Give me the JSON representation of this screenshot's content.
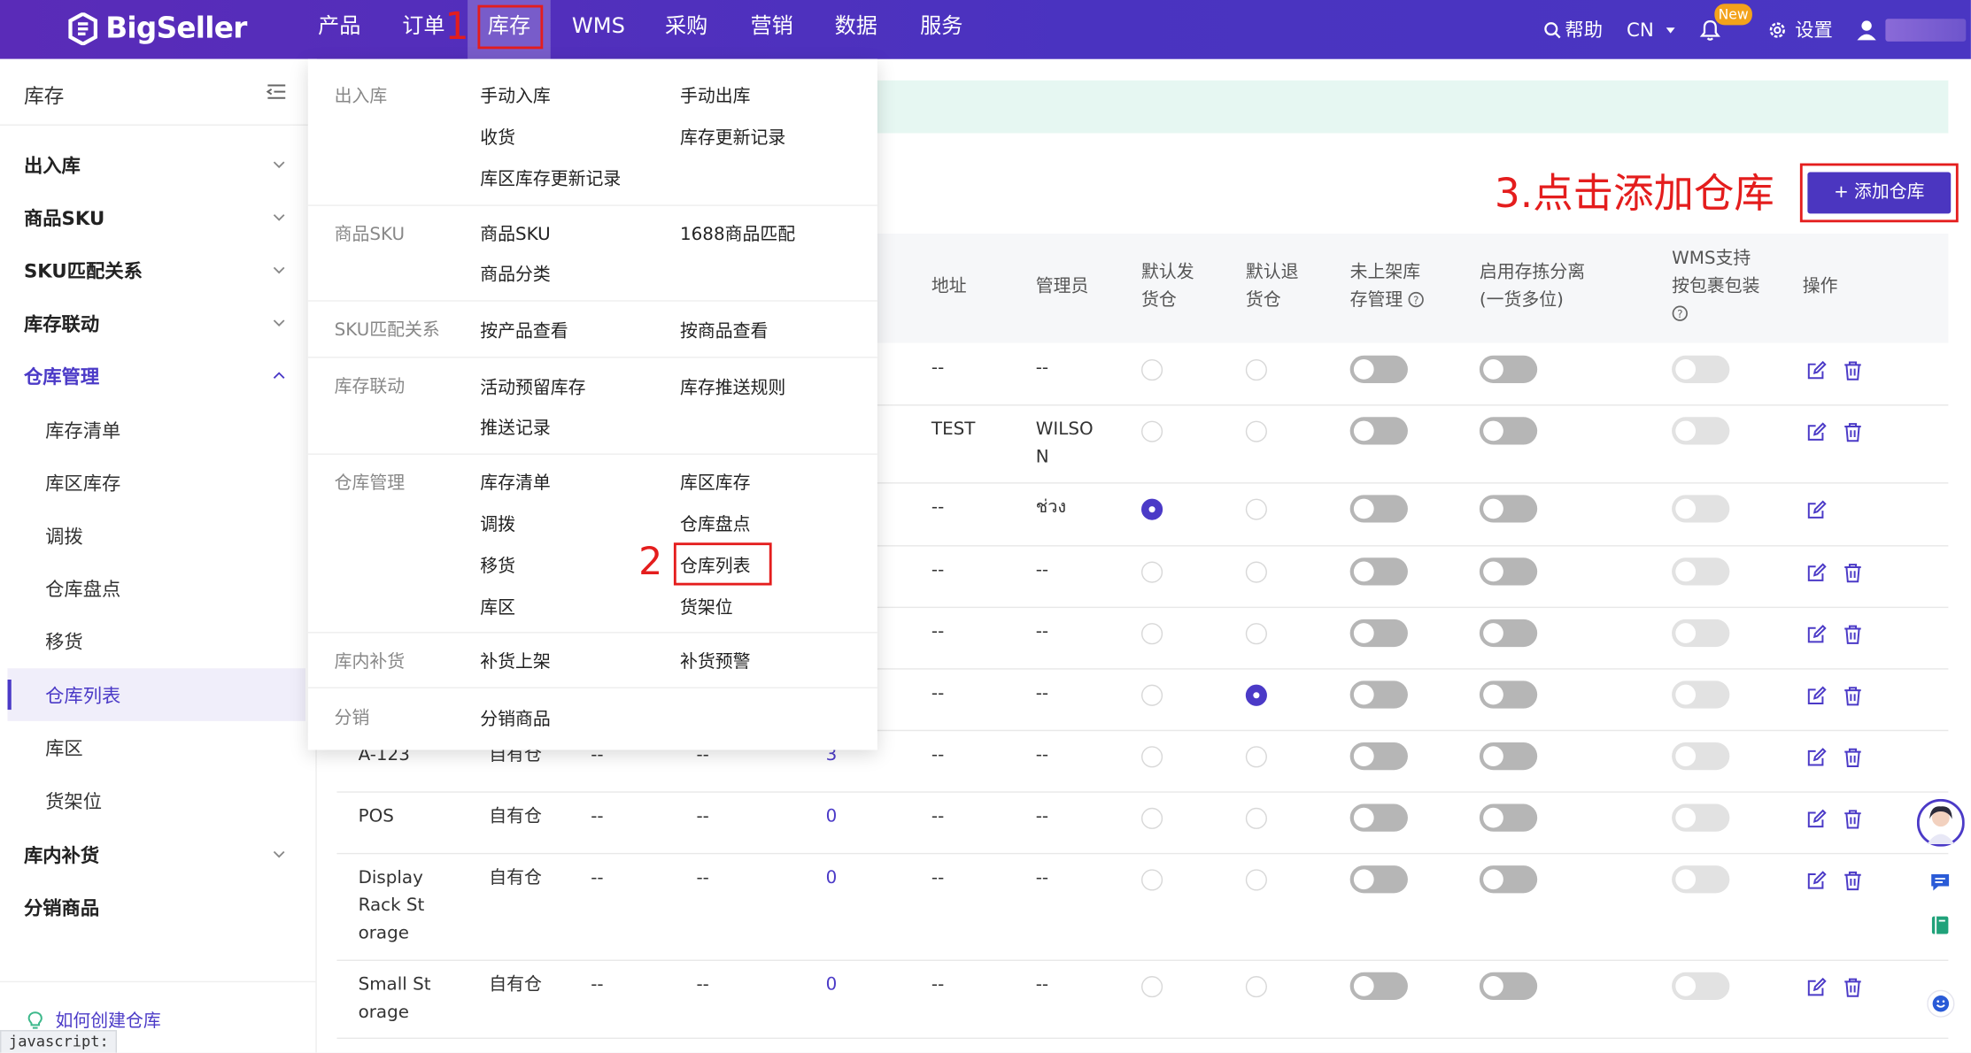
{
  "app": {
    "logo_text": "BigSeller"
  },
  "topnav": {
    "items": [
      "产品",
      "订单",
      "库存",
      "WMS",
      "采购",
      "营销",
      "数据",
      "服务"
    ],
    "help": "帮助",
    "lang": "CN",
    "new_badge": "New",
    "settings": "设置"
  },
  "annotations": {
    "step1": "1",
    "step2": "2",
    "step3": "3.点击添加仓库"
  },
  "sidebar": {
    "title": "库存",
    "groups": [
      "出入库",
      "商品SKU",
      "SKU匹配关系",
      "库存联动",
      "仓库管理"
    ],
    "subitems": [
      "库存清单",
      "库区库存",
      "调拨",
      "仓库盘点",
      "移货",
      "仓库列表",
      "库区",
      "货架位"
    ],
    "groups2": [
      "库内补货",
      "分销商品"
    ],
    "howto": "如何创建仓库",
    "status_url": "javascript:"
  },
  "dropdown": {
    "sections": [
      {
        "cat": "出入库",
        "items": [
          "手动入库",
          "手动出库",
          "收货",
          "库存更新记录",
          "库区库存更新记录"
        ]
      },
      {
        "cat": "商品SKU",
        "items": [
          "商品SKU",
          "1688商品匹配",
          "商品分类"
        ]
      },
      {
        "cat": "SKU匹配关系",
        "items": [
          "按产品查看",
          "按商品查看"
        ]
      },
      {
        "cat": "库存联动",
        "items": [
          "活动预留库存",
          "库存推送规则",
          "推送记录"
        ]
      },
      {
        "cat": "仓库管理",
        "items": [
          "库存清单",
          "库区库存",
          "调拨",
          "仓库盘点",
          "移货",
          "仓库列表",
          "库区",
          "货架位"
        ]
      },
      {
        "cat": "库内补货",
        "items": [
          "补货上架",
          "补货预警"
        ]
      },
      {
        "cat": "分销",
        "items": [
          "分销商品"
        ]
      }
    ]
  },
  "toolbar": {
    "add_warehouse": "+ 添加仓库"
  },
  "table": {
    "headers": [
      "地址",
      "管理员",
      "默认发货仓",
      "默认退货仓",
      "未上架库存管理",
      "启用存拣分离(一货多位)",
      "WMS支持按包裹包装",
      "操作"
    ],
    "rows": [
      {
        "name": "",
        "type": "",
        "c3": "",
        "c4": "",
        "count": "",
        "addr": "--",
        "mgr": "--"
      },
      {
        "name": "",
        "type": "",
        "c3": "",
        "c4": "",
        "count": "",
        "addr": "TEST",
        "mgr": "WILSON"
      },
      {
        "name": "",
        "type": "",
        "c3": "",
        "c4": "",
        "count": "",
        "addr": "--",
        "mgr": "ช่วง"
      },
      {
        "name": "",
        "type": "",
        "c3": "",
        "c4": "",
        "count": "",
        "addr": "--",
        "mgr": "--"
      },
      {
        "name": "",
        "type": "",
        "c3": "",
        "c4": "",
        "count": "",
        "addr": "--",
        "mgr": "--"
      },
      {
        "name": "",
        "type": "",
        "c3": "",
        "c4": "",
        "count": "",
        "addr": "--",
        "mgr": "--"
      },
      {
        "name": "A-123",
        "type": "自有仓",
        "c3": "--",
        "c4": "--",
        "count": "3",
        "addr": "--",
        "mgr": "--"
      },
      {
        "name": "POS",
        "type": "自有仓",
        "c3": "--",
        "c4": "--",
        "count": "0",
        "addr": "--",
        "mgr": "--"
      },
      {
        "name": "Display Rack Storage",
        "type": "自有仓",
        "c3": "--",
        "c4": "--",
        "count": "0",
        "addr": "--",
        "mgr": "--"
      },
      {
        "name": "Small Storage",
        "type": "自有仓",
        "c3": "--",
        "c4": "--",
        "count": "0",
        "addr": "--",
        "mgr": "--"
      }
    ]
  },
  "colors": {
    "brand": "#4b36c0",
    "annotation": "#e41d1d"
  }
}
